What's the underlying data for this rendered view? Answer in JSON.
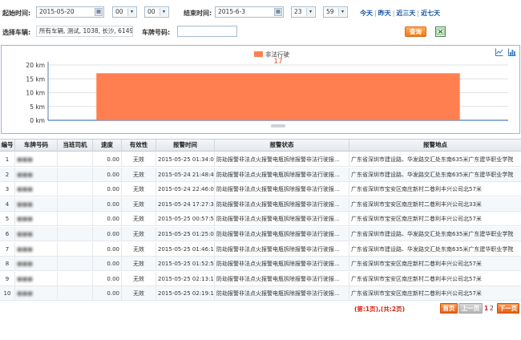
{
  "filters": {
    "start_label": "起始时间:",
    "start_date": "2015-05-20",
    "start_hour": "00",
    "start_minute": "00",
    "end_label": "结束时间:",
    "end_date": "2015-6-3",
    "end_hour": "23",
    "end_minute": "59",
    "quick_today": "今天",
    "quick_yesterday": "昨天",
    "quick_3days": "近三天",
    "quick_7days": "近七天",
    "vehicle_label": "选择车辆:",
    "vehicle_value": "所有车辆, 测试, 1038, 长沙, 61493, 60",
    "plate_label": "车牌号码:",
    "plate_value": "",
    "query_label": "查询"
  },
  "chart_data": {
    "type": "bar",
    "categories": [
      ""
    ],
    "series": [
      {
        "name": "非法行驶",
        "values": [
          17
        ]
      }
    ],
    "data_labels": [
      "17"
    ],
    "ylim": [
      0,
      20
    ],
    "yticks": [
      "0 km",
      "5 km",
      "10 km",
      "15 km",
      "20 km"
    ],
    "grid": true,
    "legend_position": "top-center",
    "bar_color": "#ff7f50"
  },
  "table": {
    "columns": [
      "编号",
      "车牌号码",
      "当班司机",
      "速度",
      "有效性",
      "报警时间",
      "报警状态",
      "报警地点"
    ],
    "rows": [
      {
        "no": "1",
        "plate": "",
        "driver": "",
        "speed": "0.00",
        "valid": "无效",
        "time": "2015-05-25 01:34:06",
        "status": "防劫报警非法点火报警电瓶拆除报警非法行驶报...",
        "place": "广东省深圳市建设路、华发路交汇处东南635米广东建华职业学院"
      },
      {
        "no": "2",
        "plate": "",
        "driver": "",
        "speed": "0.00",
        "valid": "无效",
        "time": "2015-05-24 21:48:48",
        "status": "防劫报警非法点火报警电瓶拆除报警非法行驶报...",
        "place": "广东省深圳市建设路、华发路交汇处东南635米广东建华职业学院"
      },
      {
        "no": "3",
        "plate": "",
        "driver": "",
        "speed": "0.00",
        "valid": "无效",
        "time": "2015-05-24 22:46:00",
        "status": "防劫报警非法点火报警电瓶拆除报警非法行驶报...",
        "place": "广东省深圳市宝安区南庄新村二巷利丰兴公司北57米"
      },
      {
        "no": "4",
        "plate": "",
        "driver": "",
        "speed": "0.00",
        "valid": "无效",
        "time": "2015-05-24 17:27:38",
        "status": "防劫报警非法点火报警电瓶拆除报警非法行驶报...",
        "place": "广东省深圳市宝安区南庄新村二巷利丰兴公司北33米"
      },
      {
        "no": "5",
        "plate": "",
        "driver": "",
        "speed": "0.00",
        "valid": "无效",
        "time": "2015-05-25 00:57:57",
        "status": "防劫报警非法点火报警电瓶拆除报警非法行驶报...",
        "place": "广东省深圳市宝安区南庄新村二巷利丰兴公司北57米"
      },
      {
        "no": "6",
        "plate": "",
        "driver": "",
        "speed": "0.00",
        "valid": "无效",
        "time": "2015-05-25 01:25:06",
        "status": "防劫报警非法点火报警电瓶拆除报警非法行驶报...",
        "place": "广东省深圳市建设路、华发路交汇处东南635米广东建华职业学院"
      },
      {
        "no": "7",
        "plate": "",
        "driver": "",
        "speed": "0.00",
        "valid": "无效",
        "time": "2015-05-25 01:46:15",
        "status": "防劫报警非法点火报警电瓶拆除报警非法行驶报...",
        "place": "广东省深圳市建设路、华发路交汇处东南635米广东建华职业学院"
      },
      {
        "no": "8",
        "plate": "",
        "driver": "",
        "speed": "0.00",
        "valid": "无效",
        "time": "2015-05-25 01:52:58",
        "status": "防劫报警非法点火报警电瓶拆除报警非法行驶报...",
        "place": "广东省深圳市宝安区南庄新村二巷利丰兴公司北57米"
      },
      {
        "no": "9",
        "plate": "",
        "driver": "",
        "speed": "0.00",
        "valid": "无效",
        "time": "2015-05-25 02:13:17",
        "status": "防劫报警非法点火报警电瓶拆除报警非法行驶报...",
        "place": "广东省深圳市宝安区南庄新村二巷利丰兴公司北57米"
      },
      {
        "no": "10",
        "plate": "",
        "driver": "",
        "speed": "0.00",
        "valid": "无效",
        "time": "2015-05-25 02:19:18",
        "status": "防劫报警非法点火报警电瓶拆除报警非法行驶报...",
        "place": "广东省深圳市宝安区南庄新村二巷利丰兴公司北57米"
      }
    ]
  },
  "pager": {
    "info": "(第:1页),(共:2页)",
    "first": "首页",
    "prev": "上一页",
    "page1": "1",
    "page2": "2",
    "next": "下一页"
  },
  "icons": {
    "calendar": "calendar-icon",
    "excel": "excel-export-icon",
    "line_chart": "line-chart-icon",
    "bar_chart": "bar-chart-icon"
  }
}
